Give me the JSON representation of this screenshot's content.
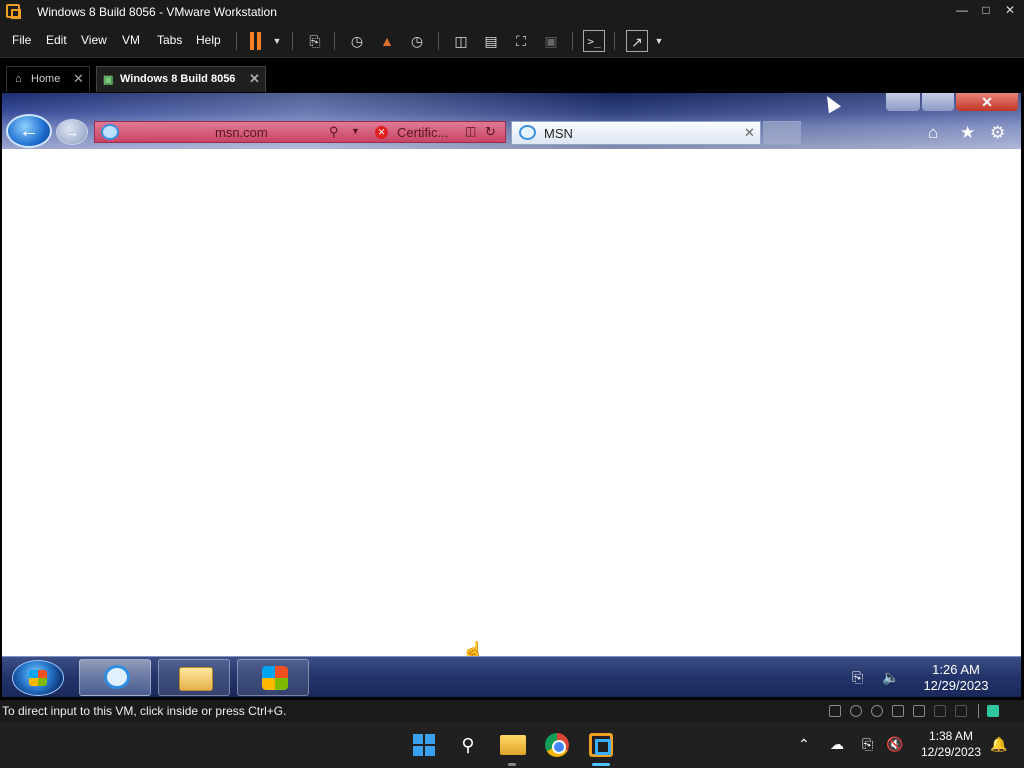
{
  "window": {
    "title": "Windows 8 Build 8056 - VMware Workstation"
  },
  "menu": {
    "items": [
      "File",
      "Edit",
      "View",
      "VM",
      "Tabs",
      "Help"
    ]
  },
  "vm_tabs": [
    {
      "label": "Home",
      "active": false
    },
    {
      "label": "Windows 8 Build 8056",
      "active": true
    }
  ],
  "guest": {
    "browser": {
      "address": "msn.com",
      "cert_label": "Certific...",
      "tab_title": "MSN"
    },
    "clock": {
      "time": "1:26 AM",
      "date": "12/29/2023"
    }
  },
  "statusbar": {
    "message": "To direct input to this VM, click inside or press Ctrl+G."
  },
  "host": {
    "clock": {
      "time": "1:38 AM",
      "date": "12/29/2023"
    }
  },
  "colors": {
    "accent": "#f08020",
    "win7_taskbar": "#23346a",
    "host_taskbar": "#202020"
  }
}
